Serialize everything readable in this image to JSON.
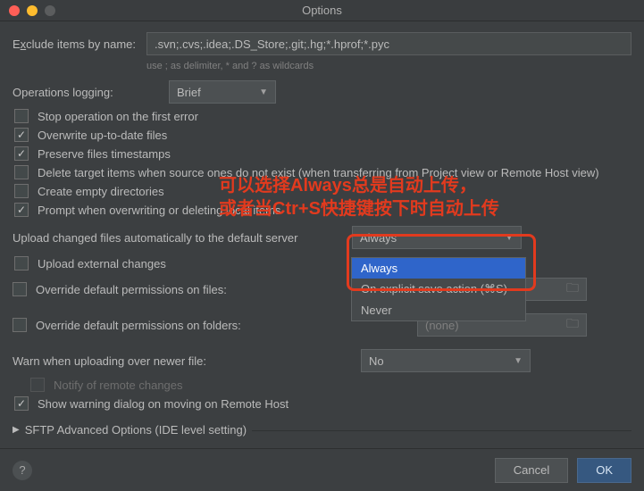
{
  "window": {
    "title": "Options"
  },
  "exclude": {
    "label_pre": "E",
    "label_mn": "x",
    "label_post": "clude items by name:",
    "value": ".svn;.cvs;.idea;.DS_Store;.git;.hg;*.hprof;*.pyc",
    "hint": "use ; as delimiter, * and ? as wildcards"
  },
  "logging": {
    "label": "Operations logging:",
    "value": "Brief"
  },
  "checks": {
    "stop_error": {
      "label": "Stop operation on the first error",
      "checked": false
    },
    "overwrite": {
      "label": "Overwrite up-to-date files",
      "checked": true
    },
    "preserve": {
      "label": "Preserve files timestamps",
      "checked": true
    },
    "delete_target": {
      "label": "Delete target items when source ones do not exist (when transferring from Project view or Remote Host view)",
      "checked": false
    },
    "create_empty": {
      "label": "Create empty directories",
      "checked": false
    },
    "prompt": {
      "label": "Prompt when overwriting or deleting local items",
      "checked": true
    }
  },
  "upload": {
    "label": "Upload changed files automatically to the default server",
    "value": "Always",
    "options": [
      "Always",
      "On explicit save action (⌘S)",
      "Never"
    ]
  },
  "upload_ext": {
    "label": "Upload external changes",
    "checked": false
  },
  "perm_files": {
    "label": "Override default permissions on files:",
    "checked": false,
    "value": "(none)"
  },
  "perm_folders": {
    "label": "Override default permissions on folders:",
    "checked": false,
    "value": "(none)"
  },
  "warn": {
    "label": "Warn when uploading over newer file:",
    "value": "No"
  },
  "notify": {
    "label": "Notify of remote changes",
    "checked": false
  },
  "show_warning": {
    "label": "Show warning dialog on moving on Remote Host",
    "checked": true
  },
  "advanced": {
    "label": "SFTP Advanced Options (IDE level setting)"
  },
  "footer": {
    "cancel": "Cancel",
    "ok": "OK"
  },
  "annotation": {
    "line1": "可以选择Always总是自动上传，",
    "line2": "或者当Ctr+S快捷键按下时自动上传"
  }
}
